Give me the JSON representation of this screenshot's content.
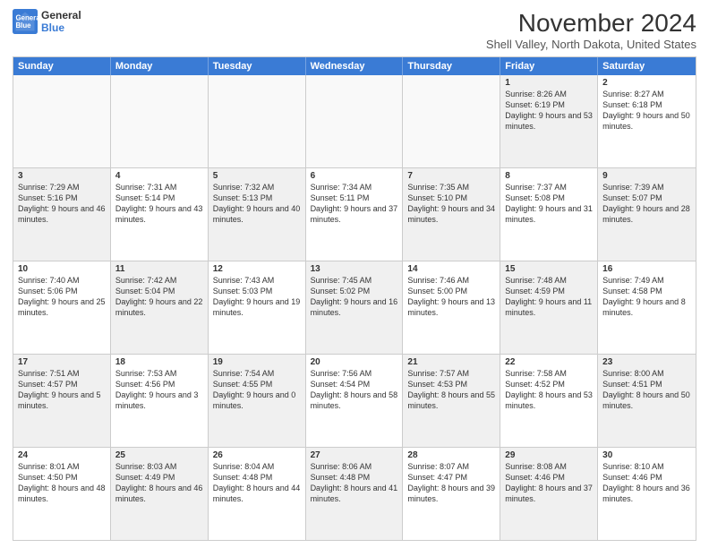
{
  "logo": {
    "line1": "General",
    "line2": "Blue"
  },
  "title": "November 2024",
  "subtitle": "Shell Valley, North Dakota, United States",
  "days": [
    "Sunday",
    "Monday",
    "Tuesday",
    "Wednesday",
    "Thursday",
    "Friday",
    "Saturday"
  ],
  "rows": [
    [
      {
        "day": "",
        "text": "",
        "empty": true
      },
      {
        "day": "",
        "text": "",
        "empty": true
      },
      {
        "day": "",
        "text": "",
        "empty": true
      },
      {
        "day": "",
        "text": "",
        "empty": true
      },
      {
        "day": "",
        "text": "",
        "empty": true
      },
      {
        "day": "1",
        "text": "Sunrise: 8:26 AM\nSunset: 6:19 PM\nDaylight: 9 hours and 53 minutes.",
        "shaded": true
      },
      {
        "day": "2",
        "text": "Sunrise: 8:27 AM\nSunset: 6:18 PM\nDaylight: 9 hours and 50 minutes.",
        "shaded": false
      }
    ],
    [
      {
        "day": "3",
        "text": "Sunrise: 7:29 AM\nSunset: 5:16 PM\nDaylight: 9 hours and 46 minutes.",
        "shaded": true
      },
      {
        "day": "4",
        "text": "Sunrise: 7:31 AM\nSunset: 5:14 PM\nDaylight: 9 hours and 43 minutes.",
        "shaded": false
      },
      {
        "day": "5",
        "text": "Sunrise: 7:32 AM\nSunset: 5:13 PM\nDaylight: 9 hours and 40 minutes.",
        "shaded": true
      },
      {
        "day": "6",
        "text": "Sunrise: 7:34 AM\nSunset: 5:11 PM\nDaylight: 9 hours and 37 minutes.",
        "shaded": false
      },
      {
        "day": "7",
        "text": "Sunrise: 7:35 AM\nSunset: 5:10 PM\nDaylight: 9 hours and 34 minutes.",
        "shaded": true
      },
      {
        "day": "8",
        "text": "Sunrise: 7:37 AM\nSunset: 5:08 PM\nDaylight: 9 hours and 31 minutes.",
        "shaded": false
      },
      {
        "day": "9",
        "text": "Sunrise: 7:39 AM\nSunset: 5:07 PM\nDaylight: 9 hours and 28 minutes.",
        "shaded": true
      }
    ],
    [
      {
        "day": "10",
        "text": "Sunrise: 7:40 AM\nSunset: 5:06 PM\nDaylight: 9 hours and 25 minutes.",
        "shaded": false
      },
      {
        "day": "11",
        "text": "Sunrise: 7:42 AM\nSunset: 5:04 PM\nDaylight: 9 hours and 22 minutes.",
        "shaded": true
      },
      {
        "day": "12",
        "text": "Sunrise: 7:43 AM\nSunset: 5:03 PM\nDaylight: 9 hours and 19 minutes.",
        "shaded": false
      },
      {
        "day": "13",
        "text": "Sunrise: 7:45 AM\nSunset: 5:02 PM\nDaylight: 9 hours and 16 minutes.",
        "shaded": true
      },
      {
        "day": "14",
        "text": "Sunrise: 7:46 AM\nSunset: 5:00 PM\nDaylight: 9 hours and 13 minutes.",
        "shaded": false
      },
      {
        "day": "15",
        "text": "Sunrise: 7:48 AM\nSunset: 4:59 PM\nDaylight: 9 hours and 11 minutes.",
        "shaded": true
      },
      {
        "day": "16",
        "text": "Sunrise: 7:49 AM\nSunset: 4:58 PM\nDaylight: 9 hours and 8 minutes.",
        "shaded": false
      }
    ],
    [
      {
        "day": "17",
        "text": "Sunrise: 7:51 AM\nSunset: 4:57 PM\nDaylight: 9 hours and 5 minutes.",
        "shaded": true
      },
      {
        "day": "18",
        "text": "Sunrise: 7:53 AM\nSunset: 4:56 PM\nDaylight: 9 hours and 3 minutes.",
        "shaded": false
      },
      {
        "day": "19",
        "text": "Sunrise: 7:54 AM\nSunset: 4:55 PM\nDaylight: 9 hours and 0 minutes.",
        "shaded": true
      },
      {
        "day": "20",
        "text": "Sunrise: 7:56 AM\nSunset: 4:54 PM\nDaylight: 8 hours and 58 minutes.",
        "shaded": false
      },
      {
        "day": "21",
        "text": "Sunrise: 7:57 AM\nSunset: 4:53 PM\nDaylight: 8 hours and 55 minutes.",
        "shaded": true
      },
      {
        "day": "22",
        "text": "Sunrise: 7:58 AM\nSunset: 4:52 PM\nDaylight: 8 hours and 53 minutes.",
        "shaded": false
      },
      {
        "day": "23",
        "text": "Sunrise: 8:00 AM\nSunset: 4:51 PM\nDaylight: 8 hours and 50 minutes.",
        "shaded": true
      }
    ],
    [
      {
        "day": "24",
        "text": "Sunrise: 8:01 AM\nSunset: 4:50 PM\nDaylight: 8 hours and 48 minutes.",
        "shaded": false
      },
      {
        "day": "25",
        "text": "Sunrise: 8:03 AM\nSunset: 4:49 PM\nDaylight: 8 hours and 46 minutes.",
        "shaded": true
      },
      {
        "day": "26",
        "text": "Sunrise: 8:04 AM\nSunset: 4:48 PM\nDaylight: 8 hours and 44 minutes.",
        "shaded": false
      },
      {
        "day": "27",
        "text": "Sunrise: 8:06 AM\nSunset: 4:48 PM\nDaylight: 8 hours and 41 minutes.",
        "shaded": true
      },
      {
        "day": "28",
        "text": "Sunrise: 8:07 AM\nSunset: 4:47 PM\nDaylight: 8 hours and 39 minutes.",
        "shaded": false
      },
      {
        "day": "29",
        "text": "Sunrise: 8:08 AM\nSunset: 4:46 PM\nDaylight: 8 hours and 37 minutes.",
        "shaded": true
      },
      {
        "day": "30",
        "text": "Sunrise: 8:10 AM\nSunset: 4:46 PM\nDaylight: 8 hours and 36 minutes.",
        "shaded": false
      }
    ]
  ]
}
